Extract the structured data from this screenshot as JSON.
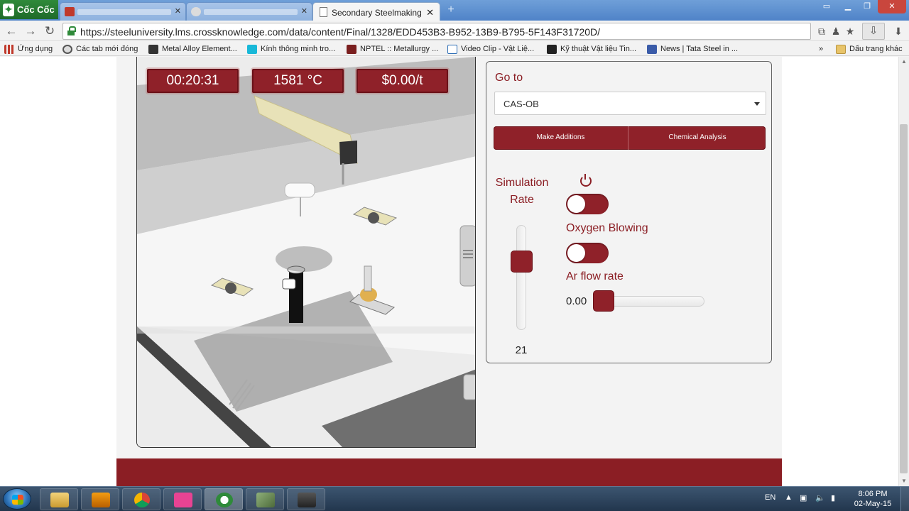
{
  "browser": {
    "brand": "Cốc Cốc",
    "active_tab": {
      "title": "Secondary Steelmaking"
    },
    "url": "https://steeluniversity.lms.crossknowledge.com/data/content/Final/1328/EDD453B3-B952-13B9-B795-5F143F31720D/",
    "bookmarks": [
      {
        "label": "Ứng dụng",
        "color": "#c0392b"
      },
      {
        "label": "Các tab mới đóng",
        "color": "#555555"
      },
      {
        "label": "Metal Alloy Element...",
        "color": "#333333"
      },
      {
        "label": "Kính thông minh tro...",
        "color": "#18b8d8"
      },
      {
        "label": "NPTEL :: Metallurgy ...",
        "color": "#7a1f1f"
      },
      {
        "label": "Video Clip - Vật Liệ...",
        "color": "#2d6db5"
      },
      {
        "label": "Kỹ thuật Vật liệu Tin...",
        "color": "#222222"
      },
      {
        "label": "News | Tata Steel in ...",
        "color": "#3a5ba8"
      }
    ],
    "bookmarks_overflow": "»",
    "other_bookmarks": "Dấu trang khác"
  },
  "simulation": {
    "hud": {
      "time": "00:20:31",
      "temperature": "1581 °C",
      "cost": "$0.00/t"
    },
    "panel": {
      "goto_label": "Go to",
      "goto_selected": "CAS-OB",
      "btn_additions": "Make Additions",
      "btn_analysis": "Chemical Analysis",
      "sim_rate_label_1": "Simulation",
      "sim_rate_label_2": "Rate",
      "sim_rate_value": "21",
      "power_on": false,
      "oxygen_label": "Oxygen Blowing",
      "oxygen_on": false,
      "ar_label": "Ar flow rate",
      "ar_value": "0.00"
    },
    "accent_color": "#8f2129"
  },
  "taskbar": {
    "language": "EN",
    "time": "8:06 PM",
    "date": "02-May-15"
  }
}
